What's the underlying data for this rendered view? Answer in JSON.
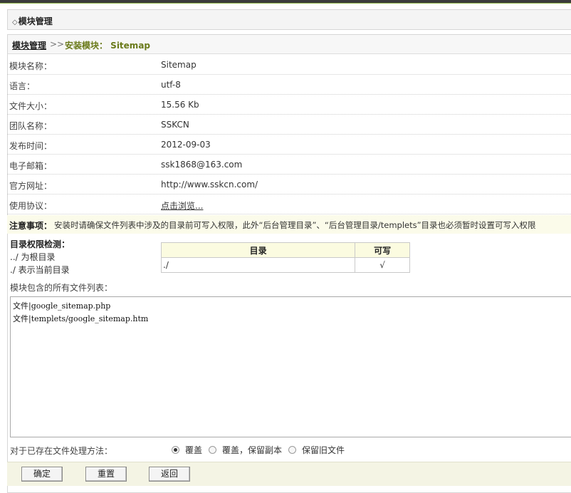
{
  "title": "模块管理",
  "breadcrumb": {
    "home": "模块管理",
    "separator": ">>",
    "current": "安装模块： Sitemap"
  },
  "fields": [
    {
      "label": "模块名称：",
      "value": "Sitemap"
    },
    {
      "label": "语言：",
      "value": "utf-8"
    },
    {
      "label": "文件大小：",
      "value": "15.56 Kb"
    },
    {
      "label": "团队名称：",
      "value": "SSKCN"
    },
    {
      "label": "发布时间：",
      "value": "2012-09-03"
    },
    {
      "label": "电子邮箱：",
      "value": "ssk1868@163.com"
    },
    {
      "label": "官方网址：",
      "value": "http://www.sskcn.com/"
    },
    {
      "label": "使用协议：",
      "value": "点击浏览..."
    }
  ],
  "notice": {
    "label": "注意事项：",
    "text": "安装时请确保文件列表中涉及的目录前可写入权限，此外“后台管理目录”、“后台管理目录/templets”目录也必须暂时设置可写入权限"
  },
  "permissions": {
    "heading": "目录权限检测：",
    "line1": "../ 为根目录",
    "line2": "./ 表示当前目录",
    "columns": [
      "目录",
      "可写"
    ],
    "rows": [
      {
        "dir": "./",
        "writable": "√"
      }
    ]
  },
  "filelist": {
    "label": "模块包含的所有文件列表：",
    "lines": [
      "文件|google_sitemap.php",
      "文件|templets/google_sitemap.htm"
    ]
  },
  "method": {
    "label": "对于已存在文件处理方法：",
    "selected": 0,
    "options": [
      "覆盖",
      "覆盖，保留副本",
      "保留旧文件"
    ]
  },
  "buttons": {
    "ok": "确定",
    "reset": "重置",
    "back": "返回"
  }
}
